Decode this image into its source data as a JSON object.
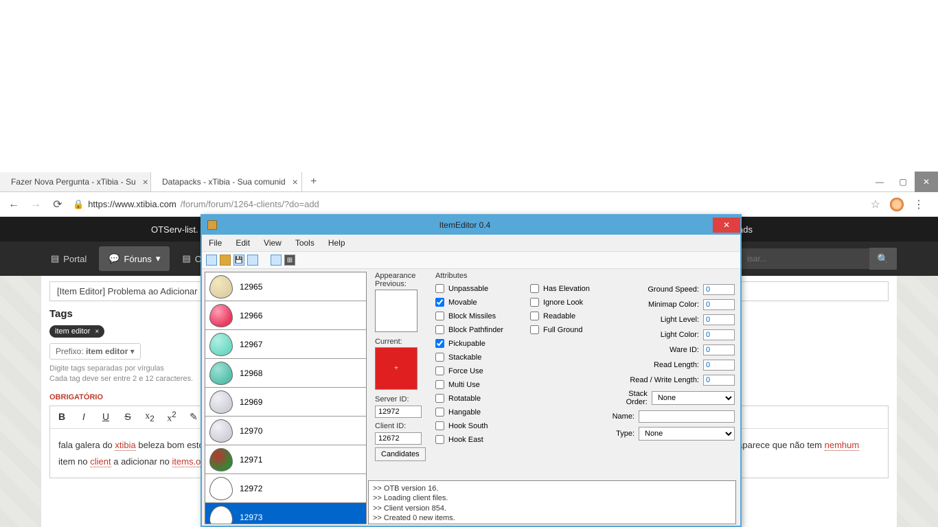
{
  "browser": {
    "tabs": [
      {
        "title": "Fazer Nova Pergunta - xTibia - Su"
      },
      {
        "title": "Datapacks - xTibia - Sua comunid"
      }
    ],
    "url_host": "https://www.xtibia.com",
    "url_path": "/forum/forum/1264-clients/?do=add"
  },
  "site": {
    "topbar": "OTServ-list.",
    "nav_portal": "Portal",
    "nav_foruns": "Fóruns",
    "nav_downloads": "nloads",
    "search_placeholder": "isar..."
  },
  "page": {
    "title_field": "[Item Editor] Problema ao Adicionar item",
    "tags_label": "Tags",
    "tag_chip": "item editor",
    "prefix_label": "Prefixo:",
    "prefix_value": "item editor",
    "help1": "Digite tags separadas por vírgulas",
    "help2": "Cada tag deve ser entre 2 e 12 caracteres.",
    "required": "OBRIGATÓRIO",
    "body_pre": "fala galera do ",
    "body_xtibia_red": "xtibia",
    "body_mid": " beleza bom esto",
    "body_end": "s aparece que não tem ",
    "body_nemhum": "nemhum",
    "body_line2a": "item no ",
    "body_client": "client",
    "body_line2b": " a adicionar no ",
    "body_itemsot": "items.ot"
  },
  "itemeditor": {
    "title": "ItemEditor 0.4",
    "menu": [
      "File",
      "Edit",
      "View",
      "Tools",
      "Help"
    ],
    "list": [
      {
        "id": "12965",
        "c1": "#e0d0a4",
        "c2": "#f3e8c0"
      },
      {
        "id": "12966",
        "c1": "#e83a5e",
        "c2": "#ff9fb5"
      },
      {
        "id": "12967",
        "c1": "#6fd9c4",
        "c2": "#b0f0e3"
      },
      {
        "id": "12968",
        "c1": "#57c0ac",
        "c2": "#9fe2d5"
      },
      {
        "id": "12969",
        "c1": "#d0d0d8",
        "c2": "#f0f0f6"
      },
      {
        "id": "12970",
        "c1": "#d0d0d8",
        "c2": "#f0f0f6"
      },
      {
        "id": "12971",
        "c1": "#338833",
        "c2": "#bb3333"
      },
      {
        "id": "12972",
        "c1": "#ffffff",
        "c2": "#ffffff"
      },
      {
        "id": "12973",
        "c1": "#ffffff",
        "c2": "#ffffff",
        "selected": true
      }
    ],
    "appearance_label": "Appearance",
    "previous_label": "Previous:",
    "current_label": "Current:",
    "serverid_label": "Server ID:",
    "serverid_value": "12972",
    "clientid_label": "Client ID:",
    "clientid_value": "12672",
    "candidates_btn": "Candidates",
    "attributes_label": "Attributes",
    "checks_col1": [
      {
        "label": "Unpassable",
        "v": false
      },
      {
        "label": "Movable",
        "v": true
      },
      {
        "label": "Block Missiles",
        "v": false
      },
      {
        "label": "Block Pathfinder",
        "v": false
      },
      {
        "label": "Pickupable",
        "v": true
      },
      {
        "label": "Stackable",
        "v": false
      },
      {
        "label": "Force Use",
        "v": false
      },
      {
        "label": "Multi Use",
        "v": false
      },
      {
        "label": "Rotatable",
        "v": false
      },
      {
        "label": "Hangable",
        "v": false
      },
      {
        "label": "Hook South",
        "v": false
      },
      {
        "label": "Hook East",
        "v": false
      }
    ],
    "checks_col2": [
      {
        "label": "Has Elevation",
        "v": false
      },
      {
        "label": "Ignore Look",
        "v": false
      },
      {
        "label": "Readable",
        "v": false
      },
      {
        "label": "Full Ground",
        "v": false
      }
    ],
    "numrows": [
      {
        "label": "Ground Speed:",
        "v": "0"
      },
      {
        "label": "Minimap Color:",
        "v": "0"
      },
      {
        "label": "Light Level:",
        "v": "0"
      },
      {
        "label": "Light Color:",
        "v": "0"
      },
      {
        "label": "Ware ID:",
        "v": "0"
      },
      {
        "label": "Read Length:",
        "v": "0"
      },
      {
        "label": "Read / Write Length:",
        "v": "0"
      }
    ],
    "stackorder_label": "Stack Order:",
    "stackorder_value": "None",
    "name_label": "Name:",
    "name_value": "",
    "type_label": "Type:",
    "type_value": "None",
    "log": [
      ">> OTB version 16.",
      ">> Loading client files.",
      ">> Client version 854.",
      ">> Created 0 new items."
    ]
  }
}
